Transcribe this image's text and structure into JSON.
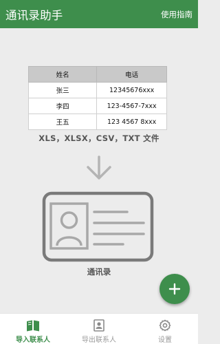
{
  "appbar": {
    "title": "通讯录助手",
    "guide_label": "使用指南"
  },
  "table": {
    "headers": [
      "姓名",
      "电话"
    ],
    "rows": [
      [
        "张三",
        "12345676xxx"
      ],
      [
        "李四",
        "123-4567-7xxx"
      ],
      [
        "王五",
        "123 4567 8xxx"
      ]
    ]
  },
  "formats_label": "XLS，XLSX，CSV，TXT 文件",
  "contacts_label": "通讯录",
  "fab": {
    "icon": "plus-icon"
  },
  "bottom_nav": {
    "items": [
      {
        "label": "导入联系人",
        "icon": "book-icon",
        "active": true
      },
      {
        "label": "导出联系人",
        "icon": "contact-card-icon",
        "active": false
      },
      {
        "label": "设置",
        "icon": "gear-icon",
        "active": false
      }
    ]
  },
  "colors": {
    "primary": "#3e8e4c",
    "background": "#ececec",
    "icon_gray": "#8a8a8a"
  }
}
